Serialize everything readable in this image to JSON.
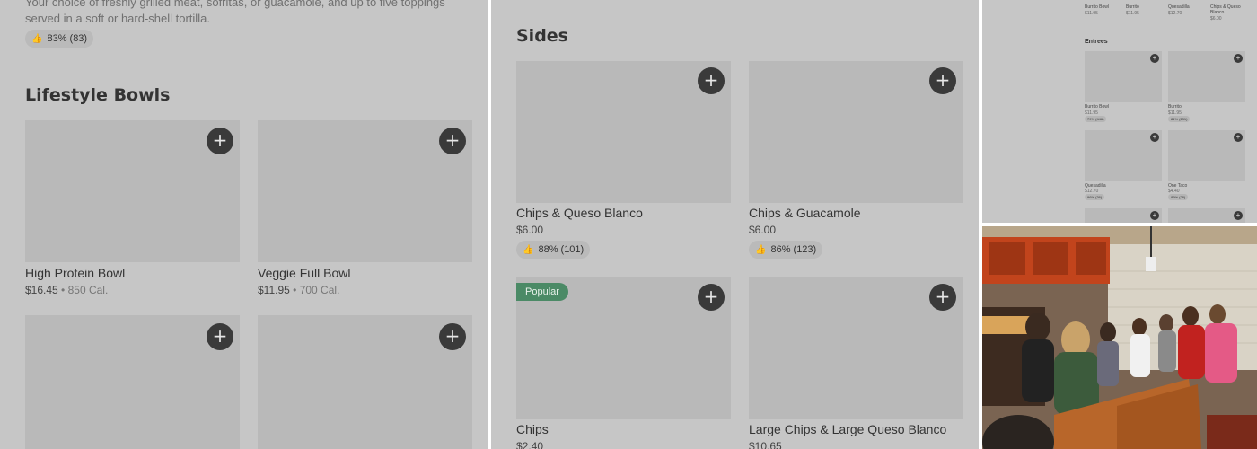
{
  "left_panel": {
    "description": "Your choice of freshly grilled meat, sofritas, or guacamole, and up to five toppings served in a soft or hard-shell tortilla.",
    "rating": "83% (83)",
    "section_title": "Lifestyle Bowls",
    "items": [
      {
        "name": "High Protein Bowl",
        "price": "$16.45",
        "calories": "850 Cal."
      },
      {
        "name": "Veggie Full Bowl",
        "price": "$11.95",
        "calories": "700 Cal."
      }
    ],
    "sep": "•"
  },
  "mid_panel": {
    "section_title": "Sides",
    "items": [
      {
        "name": "Chips & Queso Blanco",
        "price": "$6.00",
        "rating": "88% (101)"
      },
      {
        "name": "Chips & Guacamole",
        "price": "$6.00",
        "rating": "86% (123)"
      },
      {
        "name": "Chips",
        "price": "$2.40",
        "badge": "Popular"
      },
      {
        "name": "Large Chips & Large Queso Blanco",
        "price": "$10.65"
      }
    ]
  },
  "mini_panel": {
    "top_items": [
      {
        "name": "Burrito Bowl",
        "price": "$11.95"
      },
      {
        "name": "Burrito",
        "price": "$11.95"
      },
      {
        "name": "Quesadilla",
        "price": "$12.70"
      },
      {
        "name": "Chips & Queso Blanco",
        "price": "$6.00"
      }
    ],
    "section_title": "Entrees",
    "items": [
      {
        "name": "Burrito Bowl",
        "price": "$11.95",
        "rating": "79% (446)"
      },
      {
        "name": "Burrito",
        "price": "$11.95",
        "rating": "81% (231)"
      },
      {
        "name": "Quesadilla",
        "price": "$12.70",
        "rating": "96% (36)"
      },
      {
        "name": "One Taco",
        "price": "$4.40",
        "rating": "89% (28)"
      }
    ]
  },
  "icons": {
    "add": "plus-icon",
    "thumb": "thumbs-up-icon"
  },
  "plus_glyph": "+",
  "thumb_glyph": "👍",
  "colors": {
    "panel_bg": "#c6c6c6",
    "placeholder": "#b9b9b9",
    "add_button": "#3a3a3a",
    "badge": "#4b8a66"
  }
}
